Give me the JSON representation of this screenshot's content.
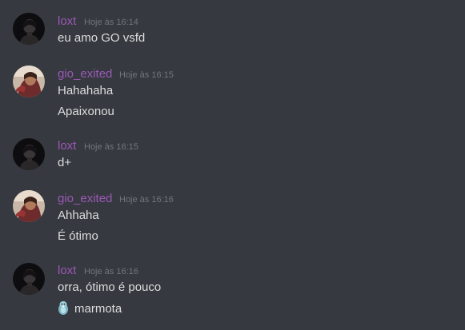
{
  "colors": {
    "background": "#36393f",
    "username_loxt": "#9b59b6",
    "username_gio": "#9b59b6",
    "timestamp": "#72767d",
    "message_text": "#dcddde"
  },
  "messages": [
    {
      "author": "loxt",
      "timestamp": "Hoje às 16:14",
      "lines": [
        "eu amo GO vsfd"
      ]
    },
    {
      "author": "gio_exited",
      "timestamp": "Hoje às 16:15",
      "lines": [
        "Hahahaha",
        "Apaixonou"
      ]
    },
    {
      "author": "loxt",
      "timestamp": "Hoje às 16:15",
      "lines": [
        "d+"
      ]
    },
    {
      "author": "gio_exited",
      "timestamp": "Hoje às 16:16",
      "lines": [
        "Ahhaha",
        "É ótimo"
      ]
    },
    {
      "author": "loxt",
      "timestamp": "Hoje às 16:16",
      "lines": [
        "orra, ótimo é pouco",
        "marmota"
      ],
      "emoji_icon": "marmot-emoji-icon"
    }
  ]
}
